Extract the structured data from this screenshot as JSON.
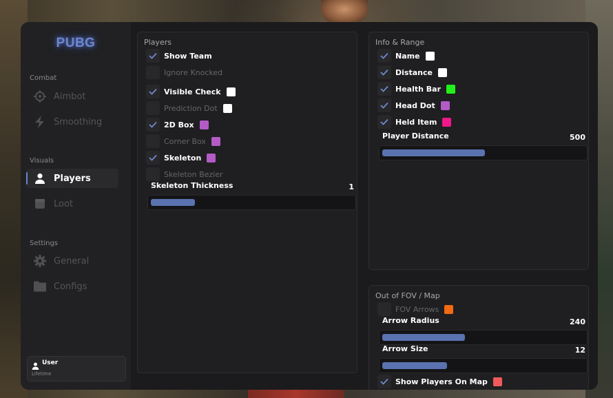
{
  "app": {
    "logo": "PUBG"
  },
  "sidebar": {
    "sections": [
      {
        "label": "Combat",
        "items": [
          {
            "label": "Aimbot",
            "icon": "crosshair-icon"
          },
          {
            "label": "Smoothing",
            "icon": "bolt-icon"
          }
        ]
      },
      {
        "label": "Visuals",
        "items": [
          {
            "label": "Players",
            "icon": "user-icon",
            "active": true
          },
          {
            "label": "Loot",
            "icon": "box-icon"
          }
        ]
      },
      {
        "label": "Settings",
        "items": [
          {
            "label": "General",
            "icon": "gear-icon"
          },
          {
            "label": "Configs",
            "icon": "folder-icon"
          }
        ]
      }
    ]
  },
  "user": {
    "name": "User",
    "tier": "Lifetime"
  },
  "players": {
    "title": "Players",
    "options": [
      {
        "label": "Show Team",
        "checked": true
      },
      {
        "label": "Ignore Knocked",
        "checked": false
      },
      {
        "label": "Visible Check",
        "checked": true,
        "color": "#ffffff"
      },
      {
        "label": "Prediction Dot",
        "checked": false,
        "color": "#ffffff"
      },
      {
        "label": "2D Box",
        "checked": true,
        "color": "#b45bc6"
      },
      {
        "label": "Corner Box",
        "checked": false,
        "color": "#b45bc6"
      },
      {
        "label": "Skeleton",
        "checked": true,
        "color": "#b45bc6"
      },
      {
        "label": "Skeleton Bezier",
        "checked": false
      }
    ],
    "slider": {
      "label": "Skeleton Thickness",
      "value": "1",
      "fill": 0.22
    }
  },
  "info": {
    "title": "Info & Range",
    "options": [
      {
        "label": "Name",
        "checked": true,
        "color": "#ffffff"
      },
      {
        "label": "Distance",
        "checked": true,
        "color": "#ffffff"
      },
      {
        "label": "Health Bar",
        "checked": true,
        "color": "#22f01a"
      },
      {
        "label": "Head Dot",
        "checked": true,
        "color": "#b45bc6"
      },
      {
        "label": "Held Item",
        "checked": true,
        "color": "#f0188a"
      }
    ],
    "slider": {
      "label": "Player Distance",
      "value": "500",
      "fill": 0.51
    }
  },
  "fov": {
    "title": "Out of FOV / Map",
    "arrows": {
      "label": "FOV Arrows",
      "checked": false,
      "color": "#f26a11"
    },
    "radius": {
      "label": "Arrow Radius",
      "value": "240",
      "fill": 0.41
    },
    "size": {
      "label": "Arrow Size",
      "value": "12",
      "fill": 0.32
    },
    "map": {
      "label": "Show Players On Map",
      "checked": true,
      "color": "#f05a5a"
    }
  }
}
